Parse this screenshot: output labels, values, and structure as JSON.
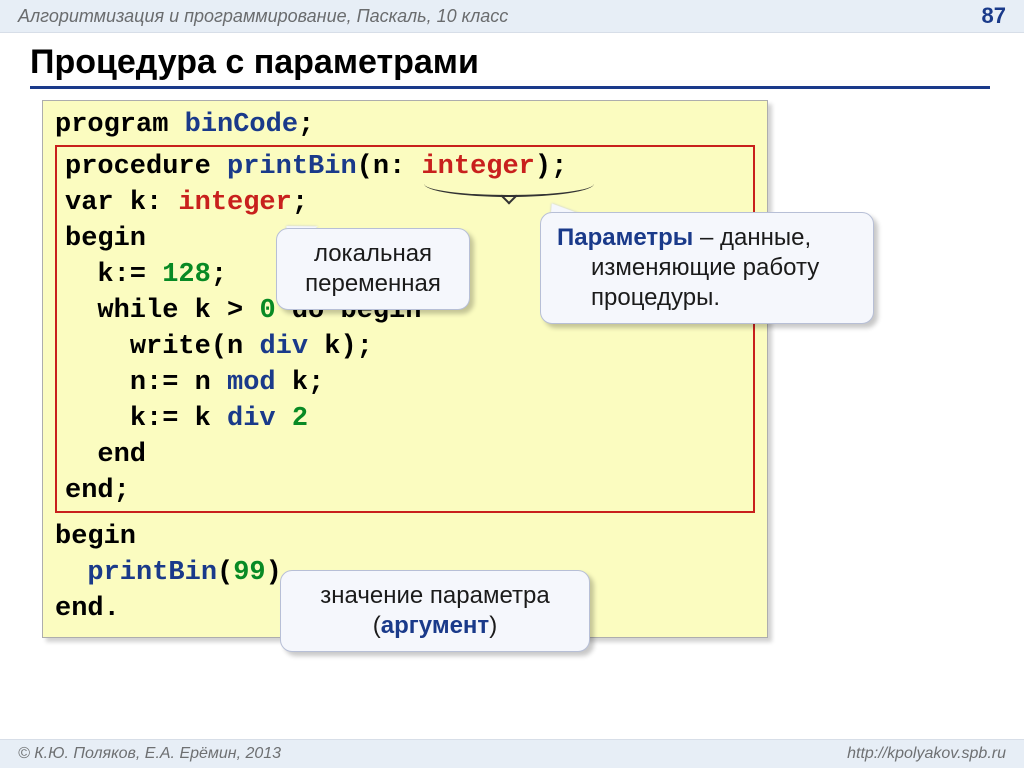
{
  "header": {
    "subject": "Алгоритмизация и программирование, Паскаль, 10 класс",
    "page": "87"
  },
  "title": "Процедура с параметрами",
  "code": {
    "l1_kw": "program",
    "l1_name": "binCode",
    "l2_kw": "procedure",
    "l2_name": "printBin",
    "l2_param": "n",
    "l2_type": "integer",
    "l3_kw": "var",
    "l3_var": "k",
    "l3_type": "integer",
    "l4": "begin",
    "l5_lhs": "k:=",
    "l5_num": "128",
    "l6_a": "while",
    "l6_b": "k",
    "l6_c": ">",
    "l6_d": "0",
    "l6_e": "do begin",
    "l7_a": "write(n",
    "l7_op": "div",
    "l7_b": "k);",
    "l8_a": "n:=",
    "l8_b": "n",
    "l8_op": "mod",
    "l8_c": "k;",
    "l9_a": "k:=",
    "l9_b": "k",
    "l9_op": "div",
    "l9_num": "2",
    "l10": "end",
    "l11": "end;",
    "l12": "begin",
    "l13_name": "printBin",
    "l13_num": "99",
    "l14": "end."
  },
  "callouts": {
    "local_l1": "локальная",
    "local_l2": "переменная",
    "param_hl": "Параметры",
    "param_rest1": " – данные,",
    "param_rest2": "изменяющие работу",
    "param_rest3": "процедуры.",
    "arg_l1": "значение параметра",
    "arg_l2a": "(",
    "arg_hl": "аргумент",
    "arg_l2b": ")"
  },
  "footer": {
    "left": "© К.Ю. Поляков, Е.А. Ерёмин, 2013",
    "right": "http://kpolyakov.spb.ru"
  }
}
